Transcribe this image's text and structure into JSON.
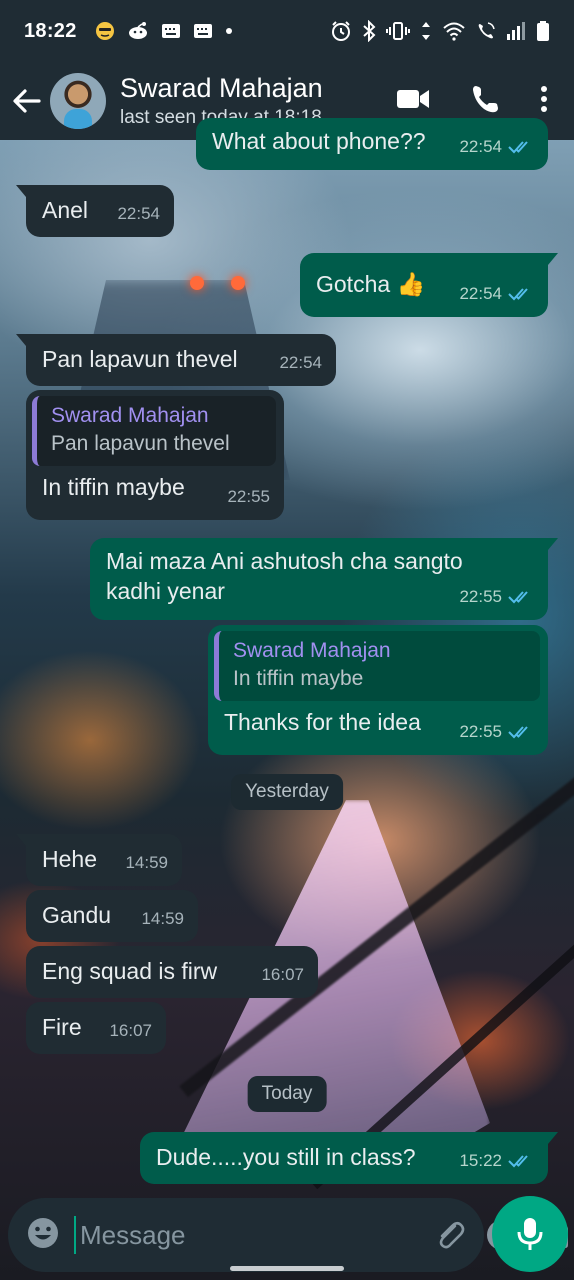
{
  "status_bar": {
    "time": "18:22",
    "left_icons": [
      "emoji-notification-icon",
      "reddit-icon",
      "keyboard-notification-icon",
      "keyboard-notification-icon",
      "dot-icon"
    ],
    "right_icons": [
      "alarm-icon",
      "bluetooth-icon",
      "vibrate-icon",
      "data-arrows-icon",
      "wifi-icon",
      "wifi-calling-icon",
      "signal-icon",
      "battery-icon"
    ]
  },
  "header": {
    "contact_name": "Swarad Mahajan",
    "last_seen": "last seen today at 18:18",
    "colors": {
      "bar": "#1f2c34"
    }
  },
  "messages": [
    {
      "dir": "out",
      "text": "What about phone??",
      "time": "22:54",
      "ticks": "read"
    },
    {
      "dir": "in",
      "text": "Anel",
      "time": "22:54"
    },
    {
      "dir": "out",
      "text": "Gotcha 👍",
      "time": "22:54",
      "ticks": "read"
    },
    {
      "dir": "in",
      "text": "Pan lapavun thevel",
      "time": "22:54"
    },
    {
      "dir": "in",
      "quote_name": "Swarad Mahajan",
      "quote_text": "Pan lapavun thevel",
      "text": "In tiffin maybe",
      "time": "22:55"
    },
    {
      "dir": "out",
      "text": "Mai maza Ani ashutosh cha sangto kadhi yenar",
      "time": "22:55",
      "ticks": "read"
    },
    {
      "dir": "out",
      "quote_name": "Swarad Mahajan",
      "quote_text": "In tiffin maybe",
      "text": "Thanks for the idea",
      "time": "22:55",
      "ticks": "read"
    },
    {
      "dir": "in",
      "text": "Hehe",
      "time": "14:59"
    },
    {
      "dir": "in",
      "text": "Gandu",
      "time": "14:59"
    },
    {
      "dir": "in",
      "text": "Eng squad is firw",
      "time": "16:07"
    },
    {
      "dir": "in",
      "text": "Fire",
      "time": "16:07"
    },
    {
      "dir": "out",
      "text": "Dude.....you still in class?",
      "time": "15:22",
      "ticks": "read"
    }
  ],
  "date_pills": {
    "yesterday": "Yesterday",
    "today": "Today"
  },
  "composer": {
    "placeholder": "Message"
  },
  "colors": {
    "incoming": "#202c33",
    "outgoing": "#005c4b",
    "accent": "#00a884",
    "read_ticks": "#53bdeb",
    "quote_name": "#a190f0"
  }
}
